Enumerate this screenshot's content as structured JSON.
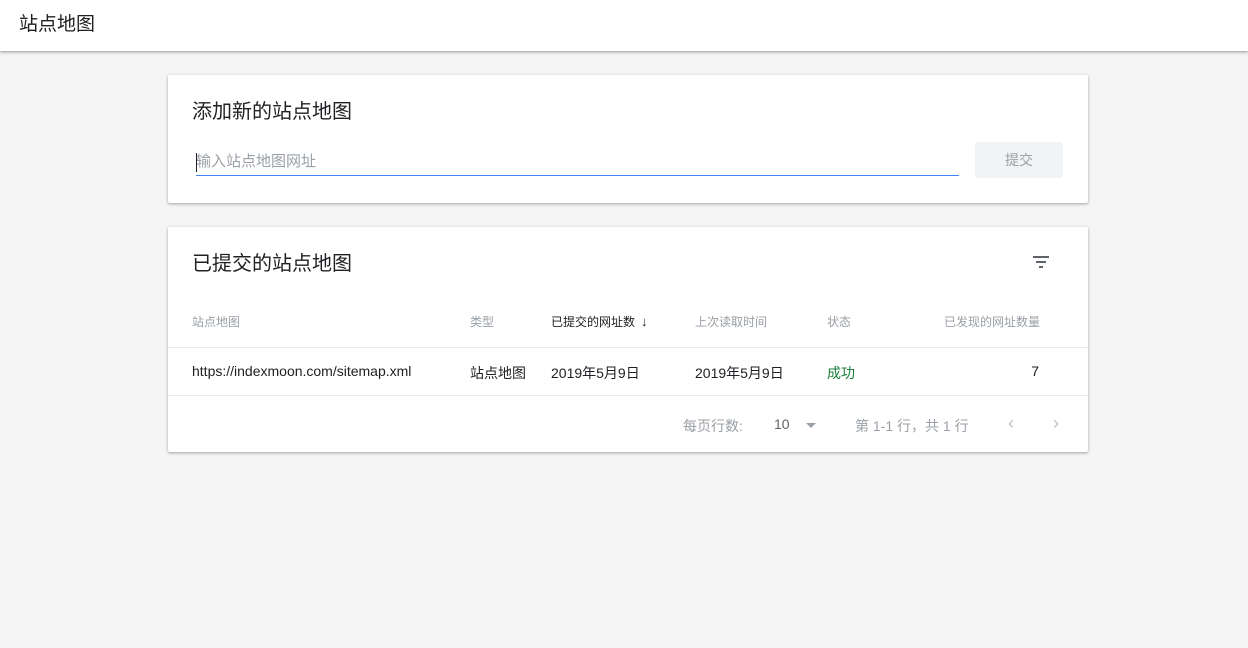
{
  "header": {
    "title": "站点地图"
  },
  "add_card": {
    "title": "添加新的站点地图",
    "input_value": "",
    "input_placeholder": "输入站点地图网址",
    "submit_label": "提交"
  },
  "submitted_card": {
    "title": "已提交的站点地图",
    "filter_icon": "filter-icon",
    "columns": [
      "站点地图",
      "类型",
      "已提交的网址数",
      "上次读取时间",
      "状态",
      "已发现的网址数量"
    ],
    "sorted_column_index": 2,
    "sort_direction": "descending",
    "rows": [
      {
        "sitemap": "https://indexmoon.com/sitemap.xml",
        "type": "站点地图",
        "submitted": "2019年5月9日",
        "last_read": "2019年5月9日",
        "status": "成功",
        "discovered_urls": "7"
      }
    ],
    "pagination": {
      "rows_per_page_label": "每页行数:",
      "rows_per_page_value": "10",
      "range_text": "第 1-1 行，共 1 行"
    }
  },
  "colors": {
    "accent": "#4285f4",
    "success": "#188038",
    "background": "#f5f5f5"
  }
}
